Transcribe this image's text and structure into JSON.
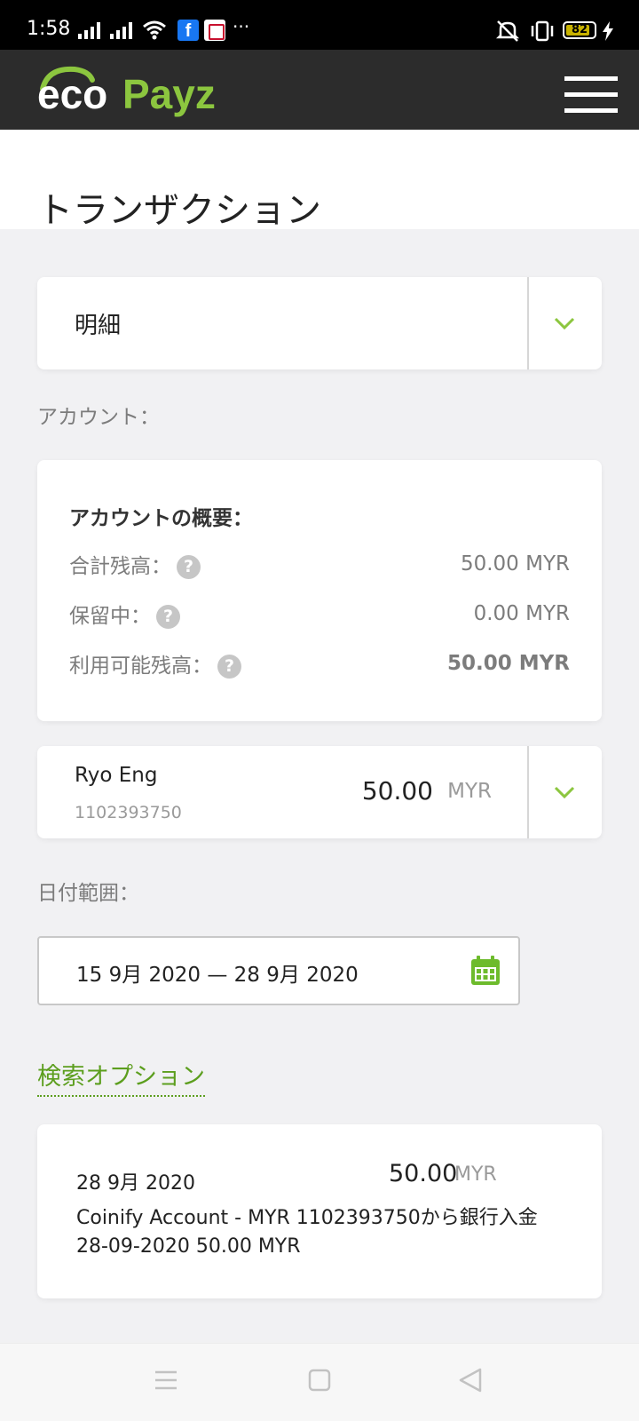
{
  "status_bar": {
    "time": "1:58",
    "more": "···",
    "battery": "82",
    "battery_level": 0.82
  },
  "header": {
    "logo_eco": "eco",
    "logo_payz": "Payz",
    "brand_green": "#8cc63f",
    "header_bg": "#2c2c2c"
  },
  "page": {
    "title": "トランザクション"
  },
  "view_select": {
    "value": "明細"
  },
  "account_label": "アカウント：",
  "summary": {
    "heading": "アカウントの概要：",
    "total_label": "合計残高：",
    "total_value": "50.00 MYR",
    "pending_label": "保留中：",
    "pending_value": "0.00 MYR",
    "available_label": "利用可能残高：",
    "available_value": "50.00 MYR"
  },
  "account_select": {
    "name": "Ryo Eng",
    "number": "1102393750",
    "amount": "50.00",
    "currency": "MYR"
  },
  "date_range": {
    "label": "日付範囲：",
    "value": "15 9月 2020 — 28 9月 2020"
  },
  "search_options": "検索オプション",
  "transactions": [
    {
      "date": "28 9月 2020",
      "amount": "50.00",
      "currency": "MYR",
      "description": "Coinify Account - MYR 1102393750から銀行入金 28-09-2020 50.00 MYR"
    }
  ],
  "colors": {
    "accent_green": "#8cc63f",
    "link_green": "#5c9e1e",
    "page_bg": "#f1f1f3"
  },
  "icons": [
    "signal-icon",
    "wifi-icon",
    "facebook-icon",
    "app-icon",
    "mute-icon",
    "vibrate-icon",
    "battery-icon",
    "charging-icon",
    "hamburger-icon",
    "chevron-down-icon",
    "help-icon",
    "calendar-icon",
    "nav-menu-icon",
    "nav-home-icon",
    "nav-back-icon"
  ]
}
